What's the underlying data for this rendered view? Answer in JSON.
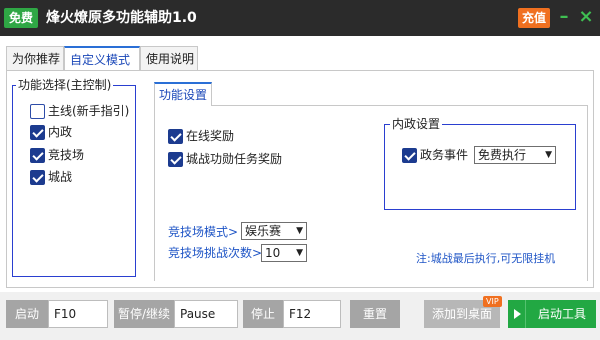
{
  "titlebar": {
    "badge": "免费",
    "title": "烽火燎原多功能辅助1.0",
    "recharge": "充值",
    "minimize": "–",
    "close": "×"
  },
  "tabs": [
    "为你推荐",
    "自定义模式",
    "使用说明"
  ],
  "function_select": {
    "title": "功能选择(主控制)",
    "items": [
      {
        "label": "主线(新手指引)",
        "checked": false
      },
      {
        "label": "内政",
        "checked": true
      },
      {
        "label": "竞技场",
        "checked": true
      },
      {
        "label": "城战",
        "checked": true
      }
    ]
  },
  "settings_tab": "功能设置",
  "options": [
    {
      "label": "在线奖励",
      "checked": true
    },
    {
      "label": "城战功勋任务奖励",
      "checked": true
    }
  ],
  "neizheng": {
    "title": "内政设置",
    "event_label": "政务事件",
    "event_checked": true,
    "event_mode": "免费执行"
  },
  "arena": {
    "mode_label": "竞技场模式>",
    "mode_value": "娱乐赛",
    "count_label": "竞技场挑战次数>",
    "count_value": "10"
  },
  "note": "注:城战最后执行,可无限挂机",
  "bottom": {
    "start_label": "启动",
    "start_key": "F10",
    "pause_label": "暂停/继续",
    "pause_key": "Pause",
    "stop_label": "停止",
    "stop_key": "F12",
    "reset_label": "重置",
    "add_desktop_label": "添加到桌面",
    "vip": "VIP",
    "start_tool_label": "启动工具"
  },
  "colors": {
    "titlebar": "#2b2b2b",
    "free_badge": "#2fa745",
    "recharge": "#f07020",
    "accent_blue": "#1f55c6",
    "start_tool": "#22a843"
  }
}
